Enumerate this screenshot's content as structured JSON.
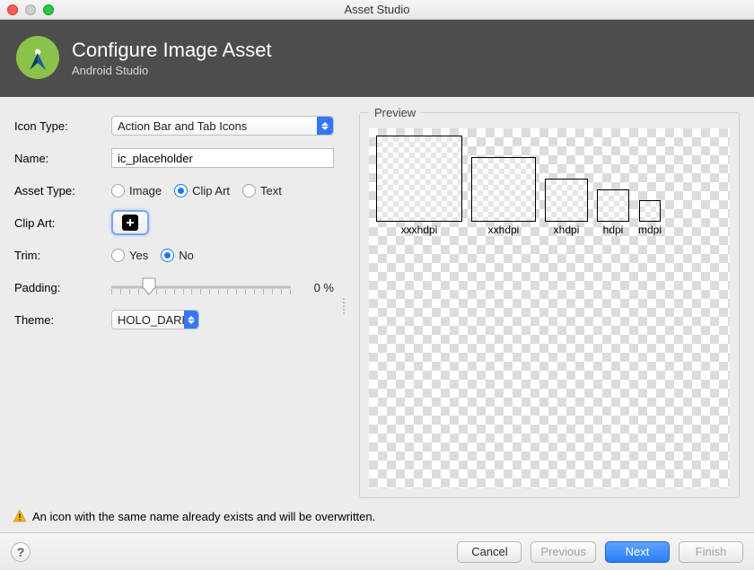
{
  "window": {
    "title": "Asset Studio"
  },
  "header": {
    "title": "Configure Image Asset",
    "subtitle": "Android Studio"
  },
  "form": {
    "icon_type": {
      "label": "Icon Type:",
      "value": "Action Bar and Tab Icons"
    },
    "name": {
      "label": "Name:",
      "value": "ic_placeholder"
    },
    "asset_type": {
      "label": "Asset Type:",
      "options": [
        {
          "label": "Image",
          "selected": false
        },
        {
          "label": "Clip Art",
          "selected": true
        },
        {
          "label": "Text",
          "selected": false
        }
      ]
    },
    "clip_art": {
      "label": "Clip Art:"
    },
    "trim": {
      "label": "Trim:",
      "options": [
        {
          "label": "Yes",
          "selected": false
        },
        {
          "label": "No",
          "selected": true
        }
      ]
    },
    "padding": {
      "label": "Padding:",
      "value": "0 %"
    },
    "theme": {
      "label": "Theme:",
      "value": "HOLO_DARK"
    }
  },
  "preview": {
    "legend": "Preview",
    "items": [
      {
        "label": "xxxhdpi",
        "size": 96
      },
      {
        "label": "xxhdpi",
        "size": 72
      },
      {
        "label": "xhdpi",
        "size": 48
      },
      {
        "label": "hdpi",
        "size": 36
      },
      {
        "label": "mdpi",
        "size": 24
      }
    ]
  },
  "warning": "An icon with the same name already exists and will be overwritten.",
  "footer": {
    "help": "?",
    "cancel": "Cancel",
    "previous": "Previous",
    "next": "Next",
    "finish": "Finish"
  }
}
